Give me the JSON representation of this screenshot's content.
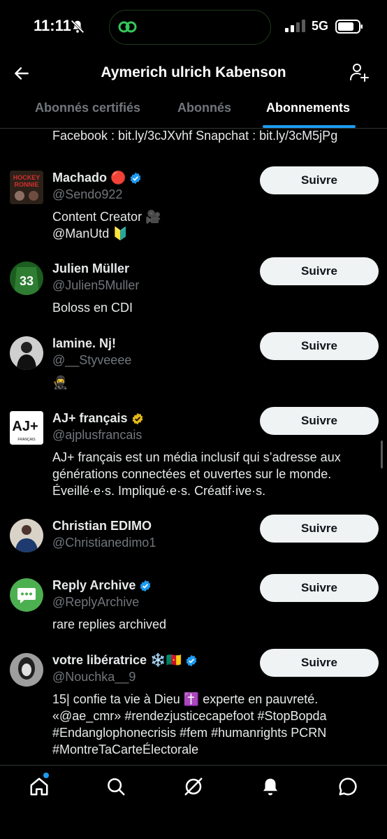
{
  "status_bar": {
    "time": "11:11",
    "network": "5G"
  },
  "header": {
    "title": "Aymerich ulrich Kabenson"
  },
  "tabs": [
    {
      "label": "Abonnés certifiés"
    },
    {
      "label": "Abonnés"
    },
    {
      "label": "Abonnements"
    }
  ],
  "top_bio": "Facebook : bit.ly/3cJXvhf Snapchat : bit.ly/3cM5jPg",
  "follow_label": "Suivre",
  "users": [
    {
      "name": "Machado 🔴",
      "handle": "@Sendo922",
      "bio": [
        "Content Creator 🎥",
        " @ManUtd 🔰"
      ],
      "verified": "blue"
    },
    {
      "name": "Julien Müller",
      "handle": "@Julien5Muller",
      "bio": [
        "Boloss en CDI"
      ],
      "verified": "none"
    },
    {
      "name": "lamine. Nj!",
      "handle": "@__Styveeee",
      "bio": [
        "🥷"
      ],
      "verified": "none"
    },
    {
      "name": "AJ+ français",
      "handle": "@ajplusfrancais",
      "bio": [
        "AJ+ français est un média inclusif qui s’adresse aux",
        "générations connectées et ouvertes sur le monde.",
        "Éveillé·e·s. Impliqué·e·s. Créatif·ive·s."
      ],
      "verified": "gold"
    },
    {
      "name": "Christian EDIMO",
      "handle": "@Christianedimo1",
      "bio": [],
      "verified": "none"
    },
    {
      "name": "Reply Archive",
      "handle": "@ReplyArchive",
      "bio": [
        "rare replies archived"
      ],
      "verified": "blue"
    },
    {
      "name": "votre libératrice ❄️🇨🇲",
      "handle": "@Nouchka__9",
      "bio": [
        "15| confie ta vie à Dieu ✝️ experte en pauvreté.",
        "«@ae_cmr» #rendezjusticecapefoot #StopBopda",
        "#Endanglophonecrisis #fem #humanrights PCRN",
        "#MontreTaCarteÉlectorale"
      ],
      "verified": "blue"
    }
  ],
  "avatars": {
    "machado": {
      "lines": [
        "HOCKEY",
        "RONNIE"
      ]
    },
    "julien": {
      "number": "33"
    },
    "ajplus": {
      "logo": "AJ+",
      "sub": "FRANÇAIS"
    }
  },
  "colors": {
    "accent": "#1d9bf0",
    "gold": "#e2b719",
    "background": "#000000"
  },
  "nav": [
    "home-icon",
    "search-icon",
    "grok-icon",
    "notifications-icon",
    "messages-icon"
  ]
}
